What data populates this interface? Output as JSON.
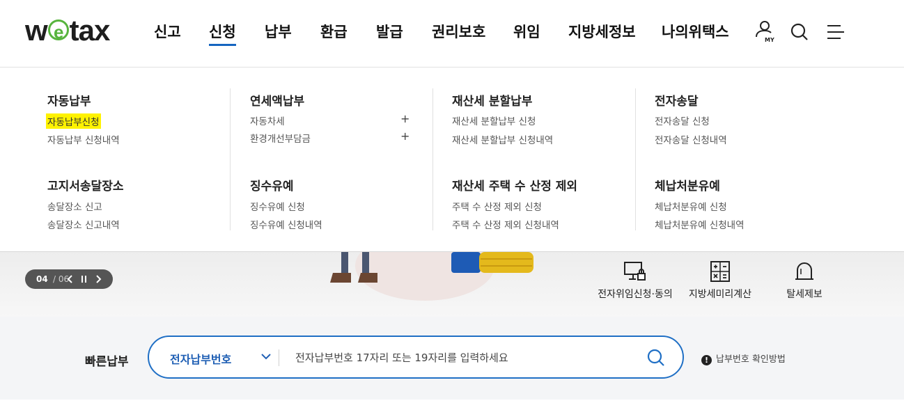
{
  "logo": {
    "pre": "w",
    "mid": "e",
    "post": "tax"
  },
  "nav": [
    {
      "label": "신고"
    },
    {
      "label": "신청",
      "active": true
    },
    {
      "label": "납부"
    },
    {
      "label": "환급"
    },
    {
      "label": "발급"
    },
    {
      "label": "권리보호"
    },
    {
      "label": "위임"
    },
    {
      "label": "지방세정보"
    },
    {
      "label": "나의위택스"
    }
  ],
  "util": {
    "my_label": "MY",
    "icons": [
      "user-my-icon",
      "search-icon",
      "menu-icon"
    ]
  },
  "mega_menu": [
    {
      "groups": [
        {
          "title": "자동납부",
          "items": [
            {
              "label": "자동납부신청",
              "highlighted": true
            },
            {
              "label": "자동납부 신청내역"
            }
          ]
        },
        {
          "title": "고지서송달장소",
          "items": [
            {
              "label": "송달장소 신고"
            },
            {
              "label": "송달장소 신고내역"
            }
          ]
        }
      ]
    },
    {
      "groups": [
        {
          "title": "연세액납부",
          "items": [
            {
              "label": "자동차세",
              "expand": "+"
            },
            {
              "label": "환경개선부담금",
              "expand": "+"
            }
          ]
        },
        {
          "title": "징수유예",
          "items": [
            {
              "label": "징수유예 신청"
            },
            {
              "label": "징수유예 신청내역"
            }
          ]
        }
      ]
    },
    {
      "groups": [
        {
          "title": "재산세 분할납부",
          "items": [
            {
              "label": "재산세 분할납부 신청"
            },
            {
              "label": "재산세 분할납부 신청내역"
            }
          ]
        },
        {
          "title": "재산세 주택 수 산정 제외",
          "items": [
            {
              "label": "주택 수 산정 제외 신청"
            },
            {
              "label": "주택 수 산정 제외 신청내역"
            }
          ]
        }
      ]
    },
    {
      "groups": [
        {
          "title": "전자송달",
          "items": [
            {
              "label": "전자송달 신청"
            },
            {
              "label": "전자송달 신청내역"
            }
          ]
        },
        {
          "title": "체납처분유예",
          "items": [
            {
              "label": "체납처분유예 신청"
            },
            {
              "label": "체납처분유예 신청내역"
            }
          ]
        }
      ]
    }
  ],
  "banner": {
    "pager_current": "04",
    "pager_total": "/ 06",
    "quick_links": [
      {
        "label": "전자위임신청·동의",
        "icon": "monitor-lock-icon"
      },
      {
        "label": "지방세미리계산",
        "icon": "calculator-icon"
      },
      {
        "label": "탈세제보",
        "icon": "alarm-bell-icon"
      }
    ]
  },
  "quick_pay": {
    "title": "빠른납부",
    "select_value": "전자납부번호",
    "placeholder": "전자납부번호 17자리 또는 19자리를 입력하세요",
    "help_label": "납부번호 확인방법"
  },
  "colors": {
    "accent": "#1f6fc5",
    "logo_green": "#57b43d",
    "highlight": "#fff200"
  }
}
